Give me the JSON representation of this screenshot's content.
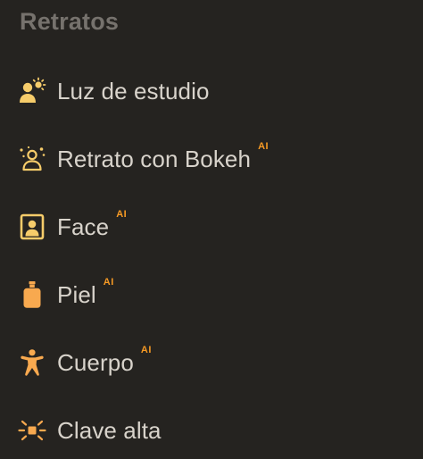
{
  "section": {
    "title": "Retratos"
  },
  "colors": {
    "background": "#252320",
    "title": "#76726d",
    "label": "#d8d3cb",
    "icon_yellow": "#f6cc6a",
    "icon_orange": "#f8a94f",
    "ai_badge": "#f79a24"
  },
  "items": [
    {
      "label": "Luz de estudio",
      "icon": "person-sun-icon",
      "ai": ""
    },
    {
      "label": "Retrato con Bokeh",
      "icon": "person-bokeh-icon",
      "ai": "AI"
    },
    {
      "label": "Face",
      "icon": "face-portrait-icon",
      "ai": "AI"
    },
    {
      "label": "Piel",
      "icon": "skin-bottle-icon",
      "ai": "AI"
    },
    {
      "label": "Cuerpo",
      "icon": "body-figure-icon",
      "ai": "AI"
    },
    {
      "label": "Clave alta",
      "icon": "high-key-light-icon",
      "ai": ""
    }
  ]
}
